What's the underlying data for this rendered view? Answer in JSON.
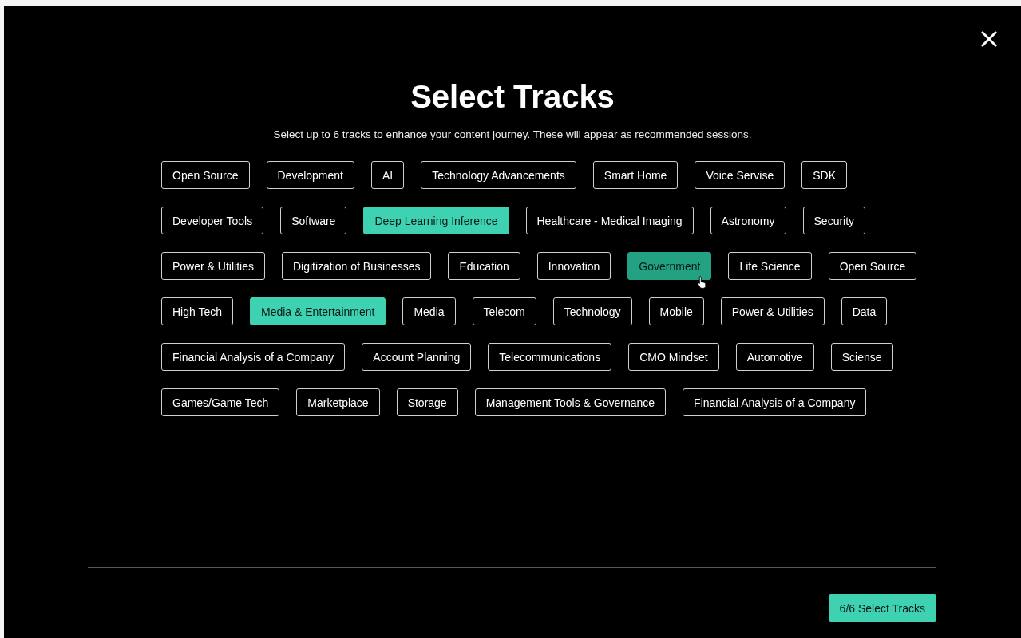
{
  "modal": {
    "title": "Select Tracks",
    "subtitle": "Select up to 6 tracks to enhance your content journey. These will appear as recommended sessions.",
    "track_rows": [
      [
        {
          "label": "Open Source",
          "selected": false,
          "hovered": false
        },
        {
          "label": "Development",
          "selected": false,
          "hovered": false
        },
        {
          "label": "AI",
          "selected": false,
          "hovered": false
        },
        {
          "label": "Technology Advancements",
          "selected": false,
          "hovered": false
        },
        {
          "label": "Smart Home",
          "selected": false,
          "hovered": false
        },
        {
          "label": "Voice Servise",
          "selected": false,
          "hovered": false
        },
        {
          "label": "SDK",
          "selected": false,
          "hovered": false
        }
      ],
      [
        {
          "label": "Developer Tools",
          "selected": false,
          "hovered": false
        },
        {
          "label": "Software",
          "selected": false,
          "hovered": false
        },
        {
          "label": "Deep Learning Inference",
          "selected": true,
          "hovered": false
        },
        {
          "label": "Healthcare - Medical Imaging",
          "selected": false,
          "hovered": false
        },
        {
          "label": "Astronomy",
          "selected": false,
          "hovered": false
        },
        {
          "label": "Security",
          "selected": false,
          "hovered": false
        }
      ],
      [
        {
          "label": "Power & Utilities",
          "selected": false,
          "hovered": false
        },
        {
          "label": "Digitization of Businesses",
          "selected": false,
          "hovered": false
        },
        {
          "label": "Education",
          "selected": false,
          "hovered": false
        },
        {
          "label": "Innovation",
          "selected": false,
          "hovered": false
        },
        {
          "label": "Government",
          "selected": true,
          "hovered": true
        },
        {
          "label": "Life Science",
          "selected": false,
          "hovered": false
        },
        {
          "label": "Open Source",
          "selected": false,
          "hovered": false
        }
      ],
      [
        {
          "label": "High Tech",
          "selected": false,
          "hovered": false
        },
        {
          "label": "Media & Entertainment",
          "selected": true,
          "hovered": false
        },
        {
          "label": "Media",
          "selected": false,
          "hovered": false
        },
        {
          "label": "Telecom",
          "selected": false,
          "hovered": false
        },
        {
          "label": "Technology",
          "selected": false,
          "hovered": false
        },
        {
          "label": "Mobile",
          "selected": false,
          "hovered": false
        },
        {
          "label": "Power & Utilities",
          "selected": false,
          "hovered": false
        },
        {
          "label": "Data",
          "selected": false,
          "hovered": false
        }
      ],
      [
        {
          "label": "Financial Analysis of a Company",
          "selected": false,
          "hovered": false
        },
        {
          "label": "Account Planning",
          "selected": false,
          "hovered": false
        },
        {
          "label": "Telecommunications",
          "selected": false,
          "hovered": false
        },
        {
          "label": "CMO Mindset",
          "selected": false,
          "hovered": false
        },
        {
          "label": "Automotive",
          "selected": false,
          "hovered": false
        },
        {
          "label": "Sciense",
          "selected": false,
          "hovered": false
        }
      ],
      [
        {
          "label": "Games/Game Tech",
          "selected": false,
          "hovered": false
        },
        {
          "label": "Marketplace",
          "selected": false,
          "hovered": false
        },
        {
          "label": "Storage",
          "selected": false,
          "hovered": false
        },
        {
          "label": "Management Tools & Governance",
          "selected": false,
          "hovered": false
        },
        {
          "label": "Financial Analysis of a Company",
          "selected": false,
          "hovered": false
        }
      ]
    ],
    "submit_button": "6/6 Select Tracks"
  }
}
